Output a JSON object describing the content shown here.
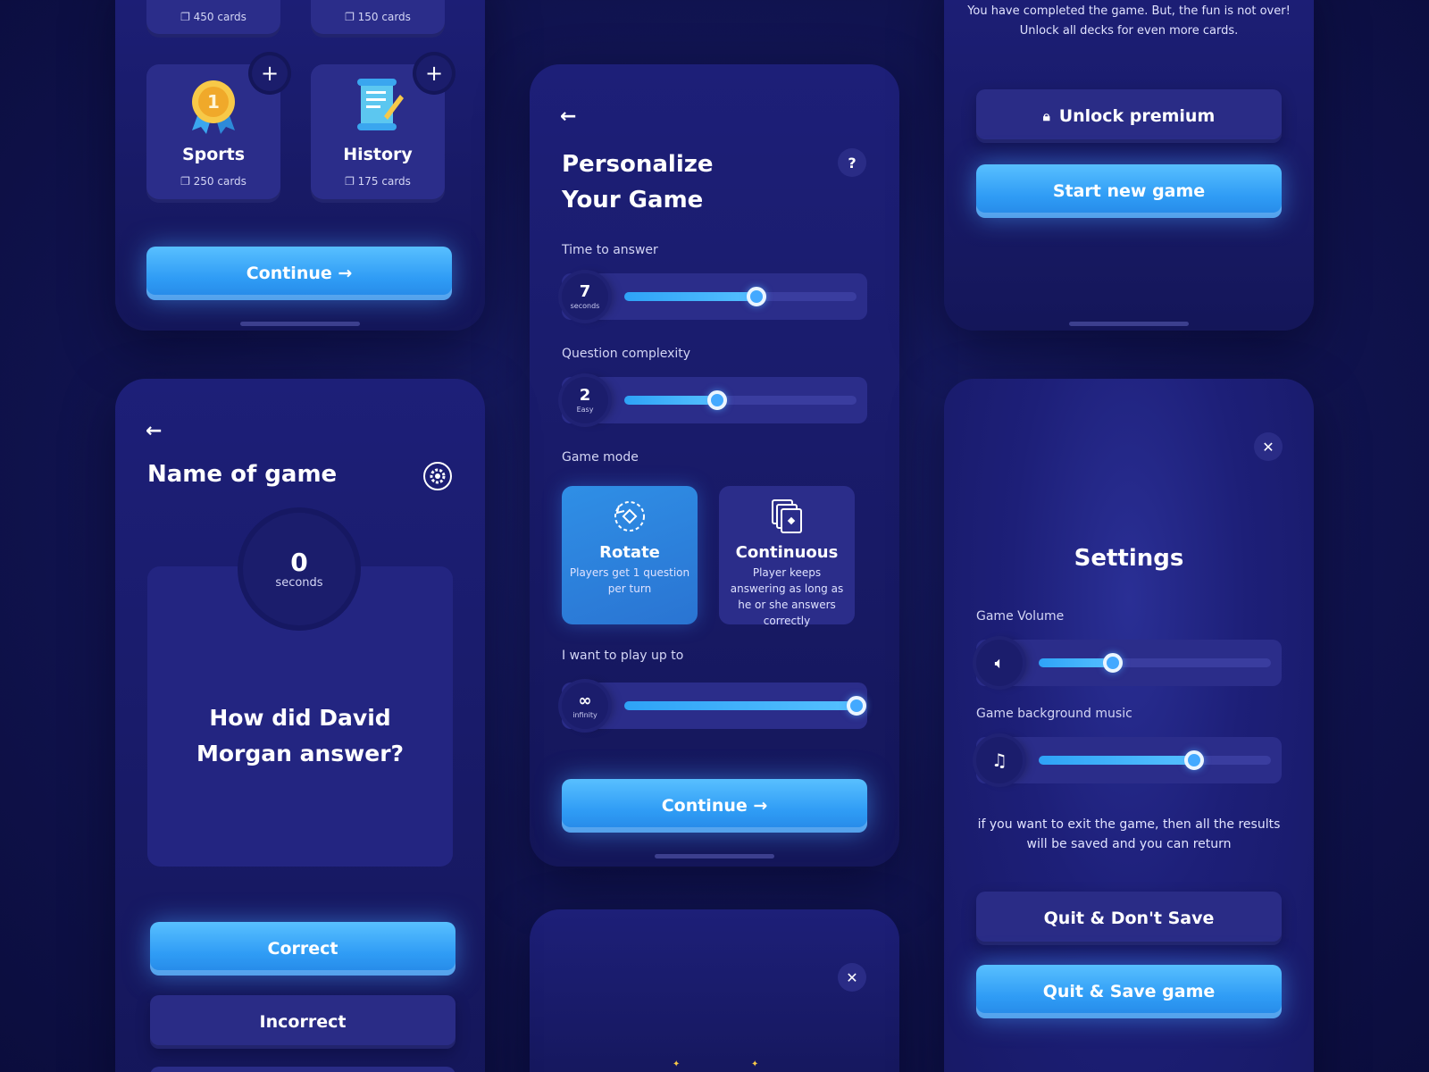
{
  "decks_screen": {
    "top_cards": [
      {
        "count": "450 cards"
      },
      {
        "count": "150 cards"
      }
    ],
    "cards": [
      {
        "title": "Sports",
        "count": "250 cards",
        "icon": "medal-icon"
      },
      {
        "title": "History",
        "count": "175 cards",
        "icon": "scroll-icon"
      }
    ],
    "continue_label": "Continue →"
  },
  "personalize_screen": {
    "title_line1": "Personalize",
    "title_line2": "Your Game",
    "help_label": "?",
    "time_label": "Time to answer",
    "time_value": "7",
    "time_unit": "seconds",
    "time_level": 0.57,
    "complexity_label": "Question complexity",
    "complexity_value": "2",
    "complexity_unit": "Easy",
    "complexity_level": 0.4,
    "mode_label": "Game mode",
    "modes": [
      {
        "title": "Rotate",
        "desc": "Players get 1 question per turn",
        "selected": true
      },
      {
        "title": "Continuous",
        "desc": "Player keeps answering as long as he or she answers correctly",
        "selected": false
      }
    ],
    "play_label": "I want to play up to",
    "play_unit": "infinity",
    "play_level": 1.0,
    "continue_label": "Continue →"
  },
  "game_over_screen": {
    "message_line1": "You have completed the game. But, the fun is not over!",
    "message_line2": "Unlock all decks for even more cards.",
    "unlock_label": "Unlock premium",
    "start_label": "Start new game"
  },
  "question_screen": {
    "title": "Name of game",
    "timer_value": "0",
    "timer_unit": "seconds",
    "question": "How did David Morgan answer?",
    "correct_label": "Correct",
    "incorrect_label": "Incorrect"
  },
  "settings_screen": {
    "title": "Settings",
    "volume_label": "Game Volume",
    "volume_level": 0.32,
    "music_label": "Game background music",
    "music_level": 0.67,
    "exit_note": "if you want to exit the game, then all the results will be saved and you can return",
    "quit_nosave_label": "Quit & Don't Save",
    "quit_save_label": "Quit & Save game"
  },
  "colors": {
    "background": "#121555",
    "panel": "#1d1f78",
    "accent_blue": "#2f9cf5",
    "dark_button": "#2a2c86"
  }
}
